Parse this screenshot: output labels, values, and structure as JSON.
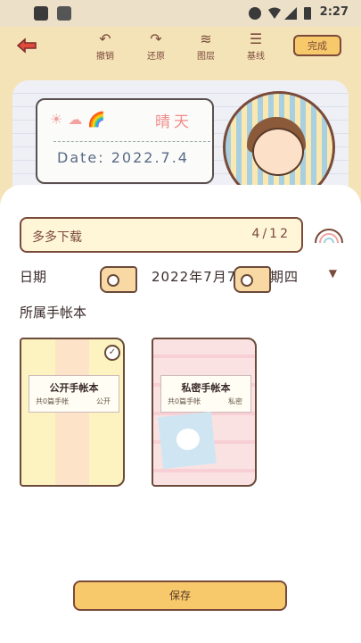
{
  "status_bar": {
    "time": "2:27"
  },
  "toolbar": {
    "undo_label": "撤销",
    "redo_label": "还原",
    "layer_label": "图层",
    "guide_label": "基线",
    "done_label": "完成"
  },
  "canvas": {
    "weather_text": "晴天",
    "date_text": "Date: 2022.7.4"
  },
  "sheet": {
    "author_name": "多多下载",
    "author_count": "4/12",
    "date_label": "日期",
    "date_value": "2022年7月7日 星期四",
    "section_title": "所属手帐本",
    "books": [
      {
        "title": "公开手帐本",
        "sub_left": "共0篇手帐",
        "sub_right": "公开",
        "selected": true
      },
      {
        "title": "私密手帐本",
        "sub_left": "共0篇手帐",
        "sub_right": "私密",
        "selected": false
      }
    ],
    "save_label": "保存"
  },
  "colors": {
    "accent": "#f7c96a",
    "border": "#7a4a3a",
    "background": "#f5e3b8"
  }
}
